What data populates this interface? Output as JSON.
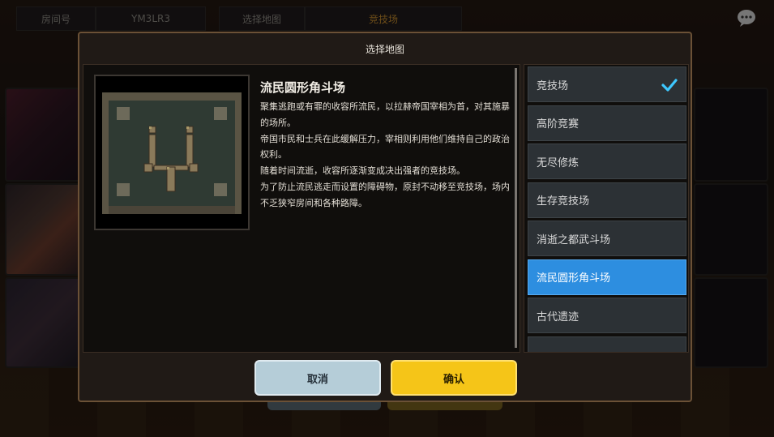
{
  "top_bar": {
    "room_label": "房间号",
    "room_id": "YM3LR3",
    "map_label": "选择地图",
    "map_value": "竞技场"
  },
  "dialog": {
    "title": "选择地图",
    "map_name": "流民圆形角斗场",
    "description": [
      "聚集逃跑或有罪的收容所流民，以拉赫帝国宰相为首，对其施暴的场所。",
      "帝国市民和士兵在此缓解压力，宰相则利用他们维持自己的政治权利。",
      "随着时间流逝，收容所逐渐变成决出强者的竞技场。",
      "为了防止流民逃走而设置的障碍物，原封不动移至竞技场，场内不乏狭窄房间和各种路障。"
    ],
    "maps": [
      {
        "label": "竞技场",
        "checked": true,
        "selected": false
      },
      {
        "label": "高阶竞赛",
        "checked": false,
        "selected": false
      },
      {
        "label": "无尽修炼",
        "checked": false,
        "selected": false
      },
      {
        "label": "生存竞技场",
        "checked": false,
        "selected": false
      },
      {
        "label": "消逝之都武斗场",
        "checked": false,
        "selected": false
      },
      {
        "label": "流民圆形角斗场",
        "checked": false,
        "selected": true
      },
      {
        "label": "古代遗迹",
        "checked": false,
        "selected": false
      },
      {
        "label": "",
        "checked": false,
        "selected": false
      }
    ],
    "cancel_label": "取消",
    "confirm_label": "确认"
  },
  "colors": {
    "accent_blue": "#2d8ee0",
    "confirm_yellow": "#f5c518",
    "cancel_blue_gray": "#b5cdd8",
    "check_cyan": "#3ec8ff",
    "dialog_border": "#6b5136"
  },
  "icons": {
    "chat": "chat-bubble-icon",
    "check": "checkmark-icon"
  }
}
